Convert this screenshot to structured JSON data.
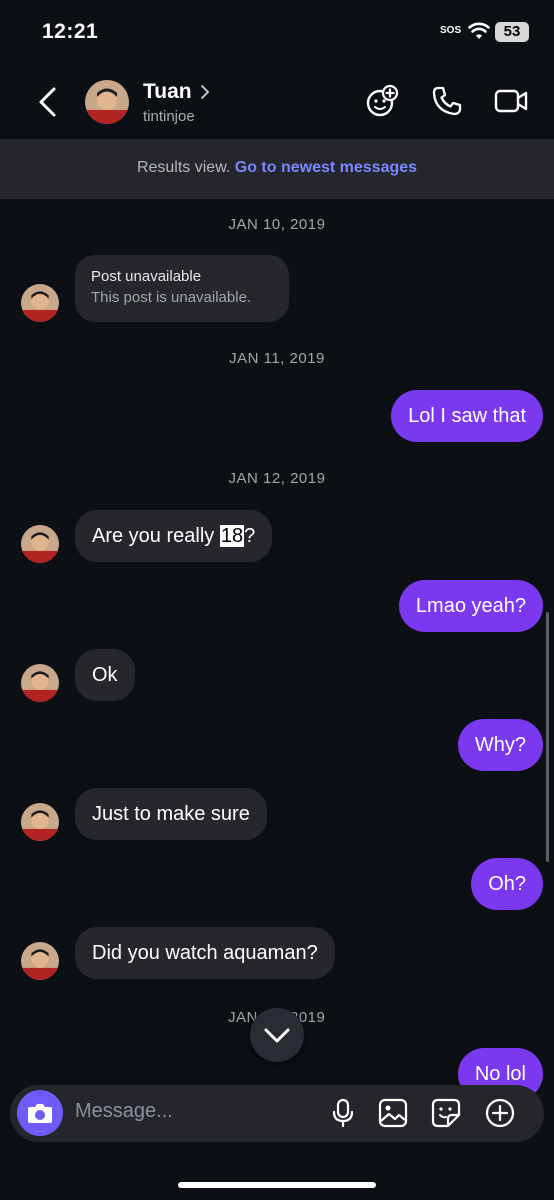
{
  "status_bar": {
    "time": "12:21",
    "sos": "SOS",
    "battery": "53"
  },
  "header": {
    "name": "Tuan",
    "username": "tintinjoe"
  },
  "banner": {
    "text": "Results view. ",
    "link": "Go to newest messages"
  },
  "composer": {
    "placeholder": "Message..."
  },
  "messages": {
    "date1": "JAN 10, 2019",
    "post_title": "Post unavailable",
    "post_sub": "This post is unavailable.",
    "date2": "JAN 11, 2019",
    "m1": "Lol I saw that",
    "date3": "JAN 12, 2019",
    "m2_pre": "Are you really ",
    "m2_hl": "18",
    "m2_post": "?",
    "m3": "Lmao yeah?",
    "m4": "Ok",
    "m5": "Why?",
    "m6": "Just to make sure",
    "m7": "Oh?",
    "m8": "Did you watch aquaman?",
    "date4_left": "JAN",
    "date4_right": "2019",
    "m9": "No lol"
  },
  "colors": {
    "accent": "#7a38ef",
    "link": "#7a87ff",
    "camera": "#6f5cf6"
  }
}
